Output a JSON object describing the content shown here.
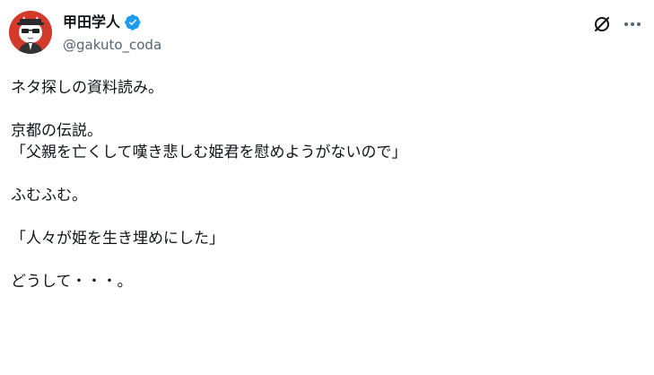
{
  "author": {
    "display_name": "甲田学人",
    "handle": "@gakuto_coda",
    "verified": true
  },
  "icons": {
    "verified": "verified-badge-icon",
    "grok": "grok-icon",
    "more": "more-options-icon",
    "avatar": "cat-avatar"
  },
  "colors": {
    "text": "#0f1419",
    "secondary_text": "#536471",
    "verified_blue": "#1d9bf0",
    "avatar_bg": "#d33a2c"
  },
  "tweet": {
    "lines": [
      "ネタ探しの資料読み。",
      "",
      "京都の伝説。",
      "「父親を亡くして嘆き悲しむ姫君を慰めようがないので」",
      "",
      "ふむふむ。",
      "",
      "「人々が姫を生き埋めにした」",
      "",
      "どうして・・・。"
    ]
  }
}
